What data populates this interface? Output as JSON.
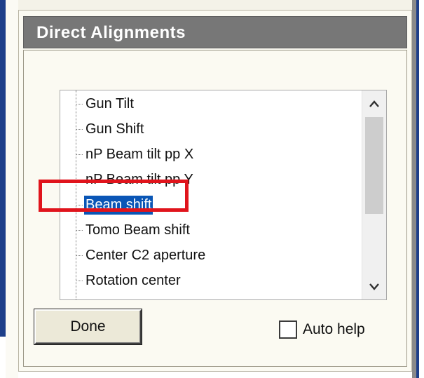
{
  "panel": {
    "title": "Direct Alignments"
  },
  "tree": {
    "items": [
      {
        "label": "Gun Tilt",
        "selected": false
      },
      {
        "label": "Gun Shift",
        "selected": false
      },
      {
        "label": "nP Beam tilt pp X",
        "selected": false
      },
      {
        "label": "nP Beam tilt pp Y",
        "selected": false
      },
      {
        "label": "Beam shift",
        "selected": true
      },
      {
        "label": "Tomo Beam shift",
        "selected": false
      },
      {
        "label": "Center C2 aperture",
        "selected": false
      },
      {
        "label": "Rotation center",
        "selected": false
      }
    ],
    "scroll_up_icon": "chevron-up-icon",
    "scroll_down_icon": "chevron-down-icon"
  },
  "buttons": {
    "done_label": "Done"
  },
  "auto_help": {
    "label": "Auto help",
    "checked": false
  },
  "colors": {
    "header_bg": "#777777",
    "selection_bg": "#0a56b6",
    "highlight_border": "#e0141c"
  }
}
